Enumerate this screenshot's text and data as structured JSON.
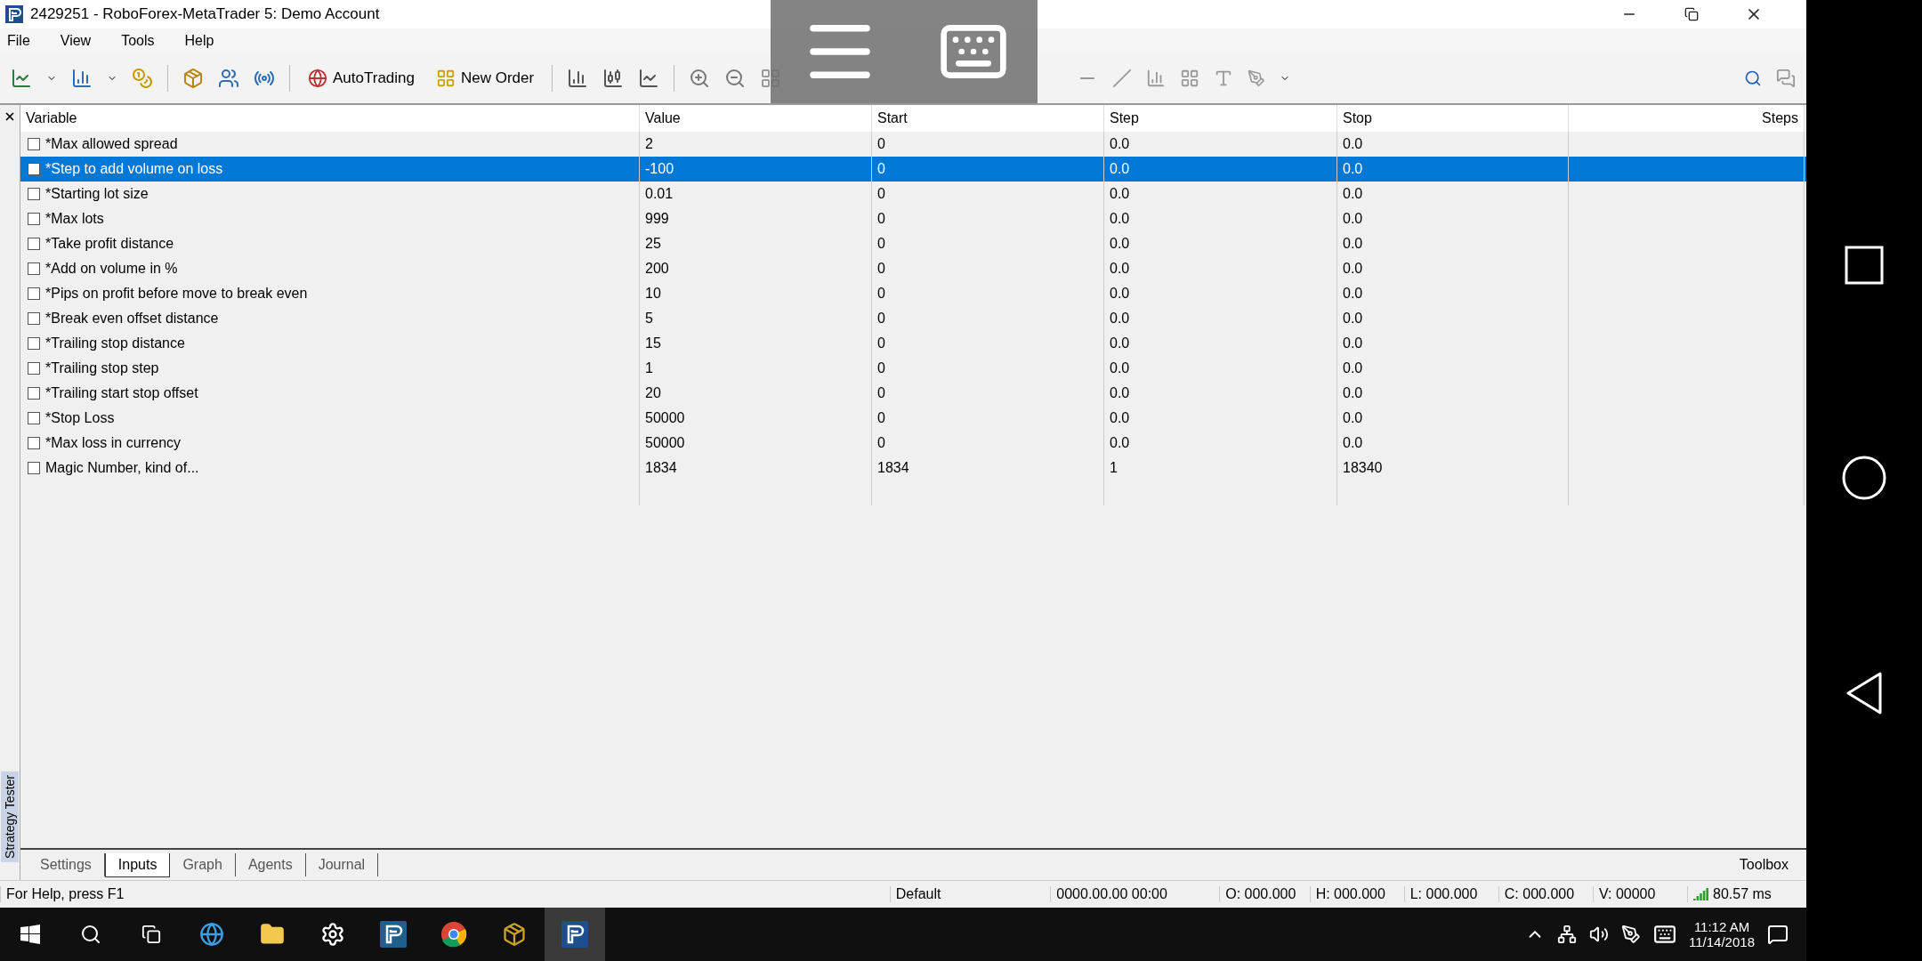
{
  "window": {
    "title": "2429251 - RoboForex-MetaTrader 5: Demo Account"
  },
  "menu": [
    "File",
    "View",
    "Tools",
    "Help"
  ],
  "toolbar": {
    "buttons": [
      "AutoTrading",
      "New Order"
    ]
  },
  "panel": {
    "side_label": "Strategy Tester"
  },
  "table": {
    "columns": [
      "Variable",
      "Value",
      "Start",
      "Step",
      "Stop",
      "Steps"
    ],
    "rows": [
      {
        "checked": false,
        "selected": false,
        "cells": [
          "*Max allowed spread",
          "2",
          "0",
          "0.0",
          "0.0"
        ]
      },
      {
        "checked": false,
        "selected": true,
        "cells": [
          "*Step to add volume on loss",
          "-100",
          "0",
          "0.0",
          "0.0"
        ]
      },
      {
        "checked": false,
        "selected": false,
        "cells": [
          "*Starting lot size",
          "0.01",
          "0",
          "0.0",
          "0.0"
        ]
      },
      {
        "checked": false,
        "selected": false,
        "cells": [
          "*Max lots",
          "999",
          "0",
          "0.0",
          "0.0"
        ]
      },
      {
        "checked": false,
        "selected": false,
        "cells": [
          "*Take profit distance",
          "25",
          "0",
          "0.0",
          "0.0"
        ]
      },
      {
        "checked": false,
        "selected": false,
        "cells": [
          "*Add on volume in %",
          "200",
          "0",
          "0.0",
          "0.0"
        ]
      },
      {
        "checked": false,
        "selected": false,
        "cells": [
          "*Pips on profit before move to break even",
          "10",
          "0",
          "0.0",
          "0.0"
        ]
      },
      {
        "checked": false,
        "selected": false,
        "cells": [
          "*Break even offset distance",
          "5",
          "0",
          "0.0",
          "0.0"
        ]
      },
      {
        "checked": false,
        "selected": false,
        "cells": [
          "*Trailing stop distance",
          "15",
          "0",
          "0.0",
          "0.0"
        ]
      },
      {
        "checked": false,
        "selected": false,
        "cells": [
          "*Trailing stop step",
          "1",
          "0",
          "0.0",
          "0.0"
        ]
      },
      {
        "checked": false,
        "selected": false,
        "cells": [
          "*Trailing start stop offset",
          "20",
          "0",
          "0.0",
          "0.0"
        ]
      },
      {
        "checked": false,
        "selected": false,
        "cells": [
          "*Stop Loss",
          "50000",
          "0",
          "0.0",
          "0.0"
        ]
      },
      {
        "checked": false,
        "selected": false,
        "cells": [
          "*Max loss in currency",
          "50000",
          "0",
          "0.0",
          "0.0"
        ]
      },
      {
        "checked": false,
        "selected": false,
        "cells": [
          "Magic Number, kind of...",
          "1834",
          "1834",
          "1",
          "18340"
        ]
      }
    ]
  },
  "tabs": [
    {
      "label": "Settings",
      "selected": false
    },
    {
      "label": "Inputs",
      "selected": true
    },
    {
      "label": "Graph",
      "selected": false
    },
    {
      "label": "Agents",
      "selected": false
    },
    {
      "label": "Journal",
      "selected": false
    }
  ],
  "toolbox": "Toolbox",
  "status_bar": [
    "For Help, press F1",
    "Default",
    "0000.00.00 00:00",
    "O: 000.000",
    "H: 000.000",
    "L: 000.000",
    "C: 000.000",
    "V: 00000",
    "80.57 ms"
  ],
  "taskbar": {
    "time": "11:12 AM",
    "date": "11/14/2018"
  }
}
